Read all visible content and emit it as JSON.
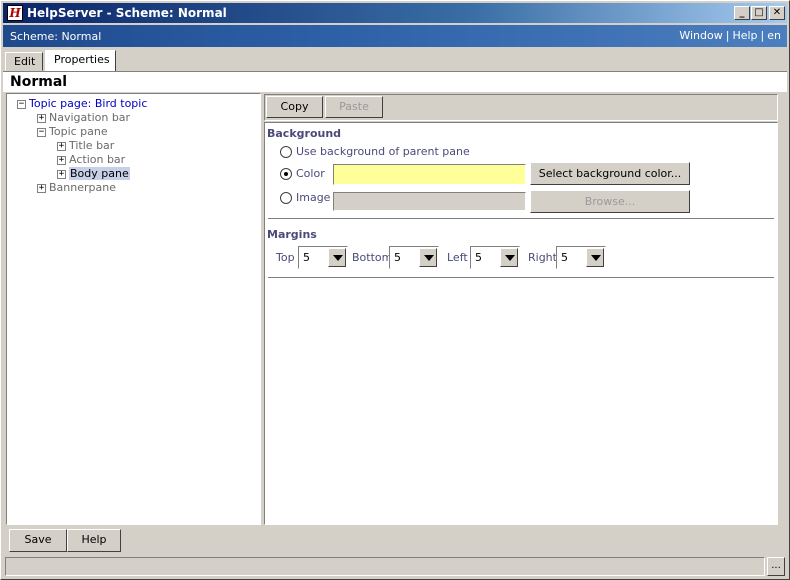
{
  "window": {
    "title": "HelpServer - Scheme: Normal",
    "app_icon_glyph": "H",
    "controls": {
      "minimize": "_",
      "maximize": "□",
      "close": "✕"
    }
  },
  "header": {
    "scheme_label": "Scheme: Normal",
    "links": [
      "Window",
      "Help",
      "en"
    ],
    "separator": "|"
  },
  "tabs": [
    {
      "label": "Edit",
      "active": false
    },
    {
      "label": "Properties",
      "active": true
    }
  ],
  "page_title": "Normal",
  "tree": [
    {
      "label": "Topic page: Bird topic",
      "expander": "−",
      "level": 0
    },
    {
      "label": "Navigation bar",
      "expander": "+",
      "level": 1
    },
    {
      "label": "Topic pane",
      "expander": "−",
      "level": 1
    },
    {
      "label": "Title bar",
      "expander": "+",
      "level": 2
    },
    {
      "label": "Action bar",
      "expander": "+",
      "level": 2
    },
    {
      "label": "Body pane",
      "expander": "+",
      "level": 2,
      "selected": true
    },
    {
      "label": "Bannerpane",
      "expander": "+",
      "level": 1
    }
  ],
  "toolbar": {
    "copy": "Copy",
    "paste": "Paste"
  },
  "background": {
    "title": "Background",
    "option_parent": "Use background of parent pane",
    "option_color": "Color",
    "option_image": "Image",
    "selected": "color",
    "color_value": "#ffff99",
    "select_color_button": "Select background color...",
    "browse_button": "Browse..."
  },
  "margins": {
    "title": "Margins",
    "top_label": "Top",
    "top_value": "5",
    "bottom_label": "Bottom",
    "bottom_value": "5",
    "left_label": "Left",
    "left_value": "5",
    "right_label": "Right",
    "right_value": "5"
  },
  "bottom": {
    "save": "Save",
    "help": "Help",
    "status_button": "..."
  }
}
